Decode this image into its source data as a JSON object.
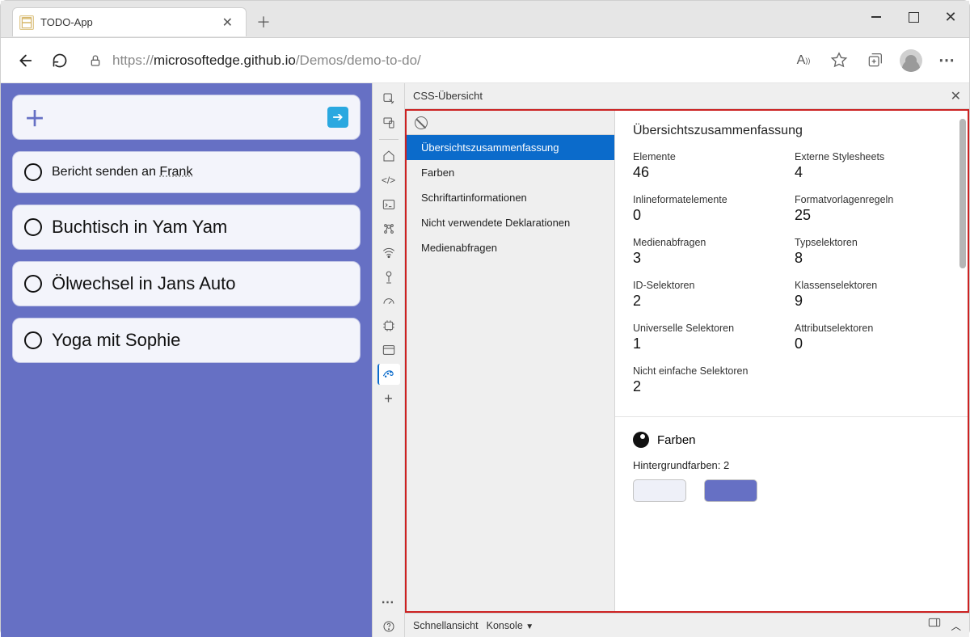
{
  "browser": {
    "tab_title": "TODO-App",
    "url_prefix": "https://",
    "url_host": "microsoftedge.github.io",
    "url_path": "/Demos/demo-to-do/"
  },
  "app": {
    "items": [
      {
        "text_a": "Bericht senden an ",
        "text_b": "Frank",
        "small": true
      },
      {
        "text_a": "Buchtisch in Yam Yam",
        "text_b": "",
        "small": false
      },
      {
        "text_a": "Ölwechsel in Jans Auto",
        "text_b": "",
        "small": false
      },
      {
        "text_a": "Yoga mit Sophie",
        "text_b": "",
        "small": false
      }
    ]
  },
  "devtools": {
    "panel_title": "CSS-Übersicht",
    "nav": {
      "summary": "Übersichtszusammenfassung",
      "colors": "Farben",
      "fonts": "Schriftartinformationen",
      "unused": "Nicht verwendete Deklarationen",
      "media": "Medienabfragen"
    },
    "summary_heading": "Übersichtszusammenfassung",
    "stats": {
      "elements_label": "Elemente",
      "elements_val": "46",
      "ext_label": "Externe Stylesheets",
      "ext_val": "4",
      "inline_label": "Inlineformatelemente",
      "inline_val": "0",
      "rules_label": "Formatvorlagenregeln",
      "rules_val": "25",
      "media_label": "Medienabfragen",
      "media_val": "3",
      "type_label": "Typselektoren",
      "type_val": "8",
      "id_label": "ID-Selektoren",
      "id_val": "2",
      "class_label": "Klassenselektoren",
      "class_val": "9",
      "univ_label": "Universelle Selektoren",
      "univ_val": "1",
      "attr_label": "Attributselektoren",
      "attr_val": "0",
      "complex_label": "Nicht einfache Selektoren",
      "complex_val": "2"
    },
    "colors": {
      "heading": "Farben",
      "bg_label": "Hintergrundfarben: 2",
      "swatch1": "#eef0f8",
      "swatch2": "#6670c4"
    },
    "footer": {
      "quick": "Schnellansicht",
      "console": "Konsole"
    }
  }
}
